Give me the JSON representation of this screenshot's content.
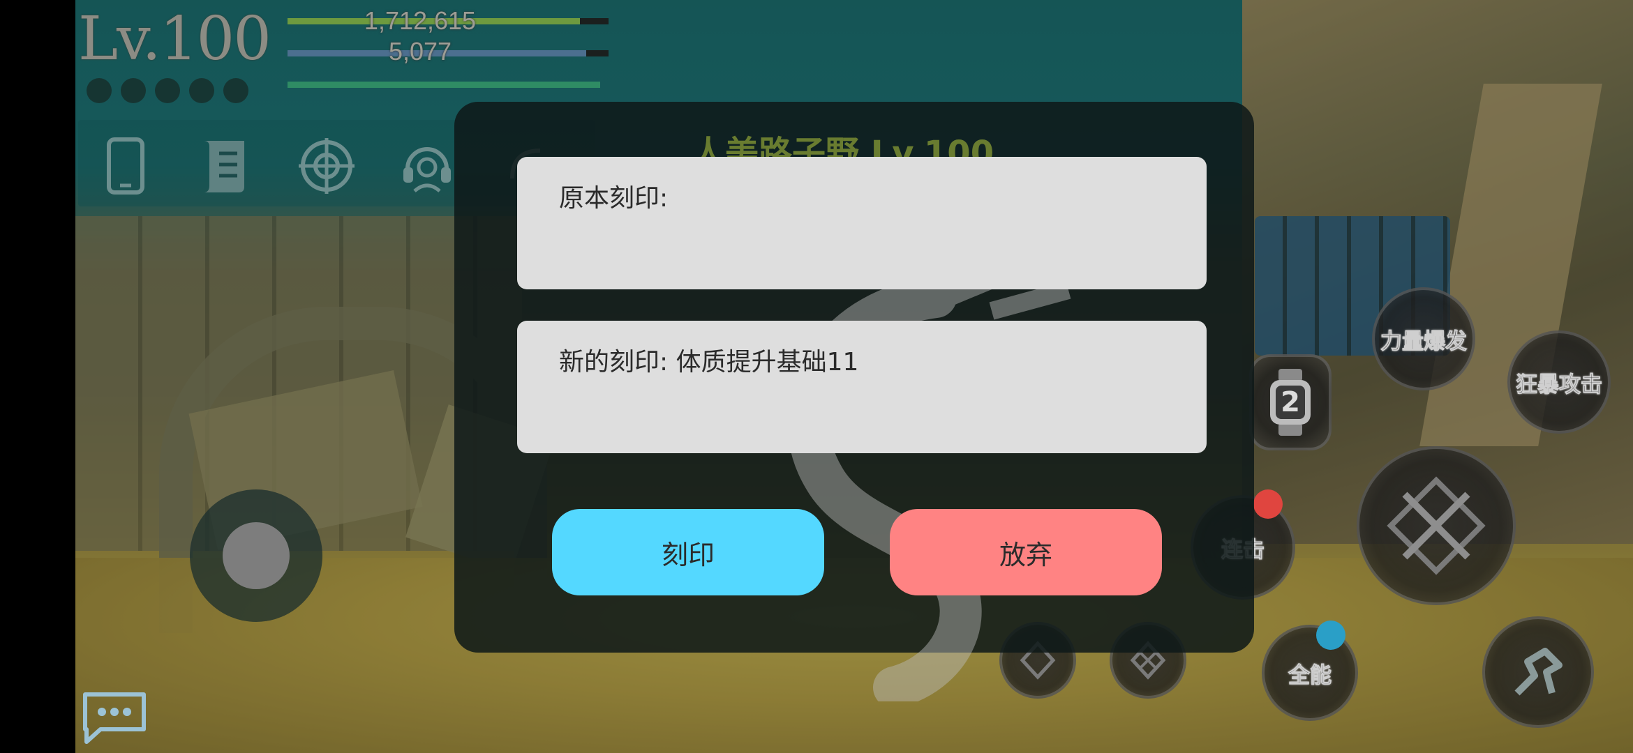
{
  "hud": {
    "level": "Lv.100",
    "exp_value": "1,712,615",
    "mp_value": "5,077",
    "exp_fill": 0.91,
    "mp_fill": 0.93
  },
  "toolbar": {
    "icons": [
      "phone-icon",
      "scroll-icon",
      "target-icon",
      "headset-icon",
      "fantasy-icon"
    ]
  },
  "skills": {
    "power_burst": "力量爆发",
    "berserk_attack": "狂暴攻击",
    "combo": "连击",
    "all_round": "全能",
    "watch_count": "2"
  },
  "dialog": {
    "background_title": "人美路子野 Lv.100",
    "original_label": "原本刻印:",
    "new_label": "新的刻印: 体质提升基础11",
    "engrave_button": "刻印",
    "abandon_button": "放弃"
  },
  "colors": {
    "engrave_button": "#54d8ff",
    "abandon_button": "#ff8383",
    "field_bg": "#dedede",
    "dialog_bg": "#0e1818"
  }
}
